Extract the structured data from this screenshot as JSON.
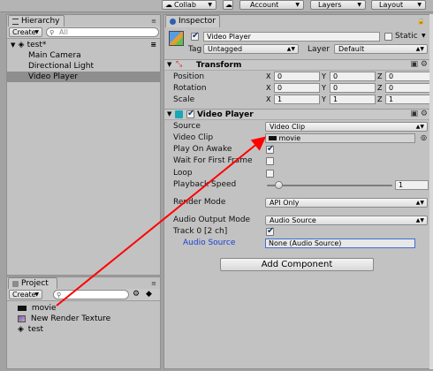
{
  "toolbar": {
    "collab_label": "Collab",
    "collab_icon": "cloud-icon",
    "account_label": "Account",
    "layers_label": "Layers",
    "layout_label": "Layout"
  },
  "hierarchy": {
    "tab_label": "Hierarchy",
    "create_label": "Create",
    "search_placeholder": "All",
    "scene_name": "test*",
    "items": [
      {
        "label": "Main Camera"
      },
      {
        "label": "Directional Light"
      },
      {
        "label": "Video Player",
        "selected": true
      }
    ]
  },
  "project": {
    "tab_label": "Project",
    "create_label": "Create",
    "search_placeholder": "",
    "items": [
      {
        "label": "movie",
        "icon": "video-clip-icon"
      },
      {
        "label": "New Render Texture",
        "icon": "render-texture-icon"
      },
      {
        "label": "test",
        "icon": "unity-scene-icon"
      }
    ]
  },
  "inspector": {
    "tab_label": "Inspector",
    "object_name": "Video Player",
    "static_label": "Static",
    "tag_label": "Tag",
    "tag_value": "Untagged",
    "layer_label": "Layer",
    "layer_value": "Default",
    "transform": {
      "title": "Transform",
      "rows": [
        {
          "label": "Position",
          "x": "0",
          "y": "0",
          "z": "0"
        },
        {
          "label": "Rotation",
          "x": "0",
          "y": "0",
          "z": "0"
        },
        {
          "label": "Scale",
          "x": "1",
          "y": "1",
          "z": "1"
        }
      ]
    },
    "video_player": {
      "title": "Video Player",
      "source_label": "Source",
      "source_value": "Video Clip",
      "video_clip_label": "Video Clip",
      "video_clip_value": "movie",
      "play_on_awake_label": "Play On Awake",
      "play_on_awake": true,
      "wait_first_frame_label": "Wait For First Frame",
      "wait_first_frame": false,
      "loop_label": "Loop",
      "loop": false,
      "playback_speed_label": "Playback Speed",
      "playback_speed": "1",
      "playback_speed_fraction": 0.1,
      "render_mode_label": "Render Mode",
      "render_mode_value": "API Only",
      "audio_output_mode_label": "Audio Output Mode",
      "audio_output_mode_value": "Audio Source",
      "track_label": "Track 0 [2 ch]",
      "track_enabled": true,
      "audio_source_label": "Audio Source",
      "audio_source_value": "None (Audio Source)"
    },
    "add_component_label": "Add Component"
  },
  "annotation": {
    "arrow_color": "#ff0000"
  },
  "colors": {
    "panel_bg": "#c2c2c2",
    "selected_row": "#8e8e8e",
    "link_blue": "#1a3fd1",
    "focus_outline": "#3f6fd6"
  }
}
